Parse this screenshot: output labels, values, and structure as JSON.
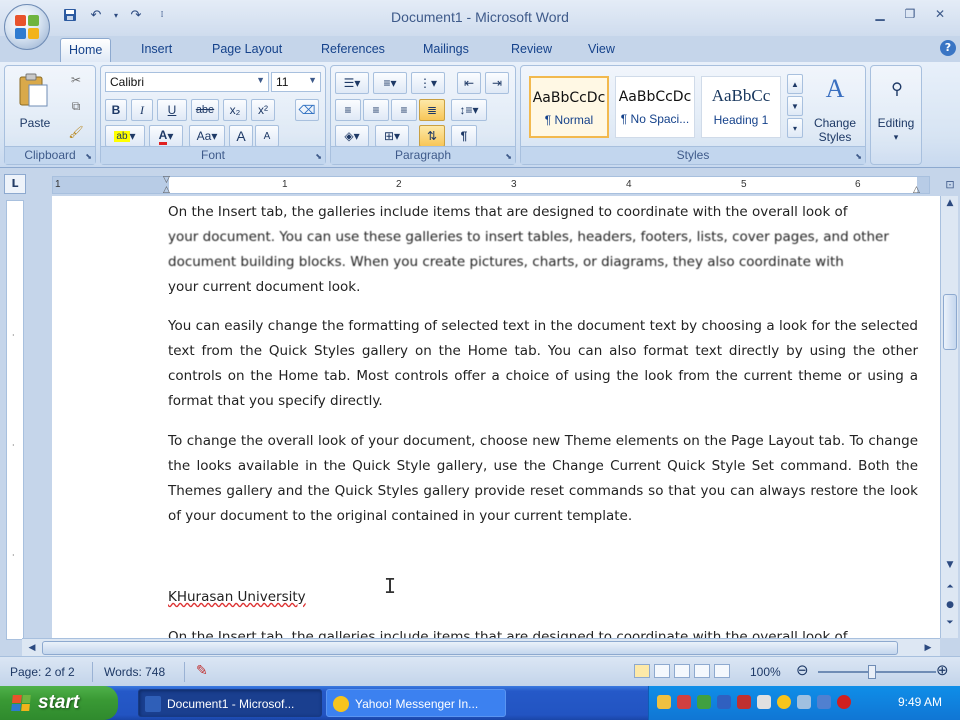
{
  "window": {
    "title": "Document1 - Microsoft Word"
  },
  "tabs": [
    "Home",
    "Insert",
    "Page Layout",
    "References",
    "Mailings",
    "Review",
    "View"
  ],
  "ribbon": {
    "clipboard": {
      "label": "Clipboard",
      "paste": "Paste"
    },
    "font": {
      "label": "Font",
      "font_name": "Calibri",
      "font_size": "11",
      "bold": "B",
      "italic": "I",
      "underline": "U",
      "strike": "abe",
      "subscript": "x₂",
      "superscript": "x²",
      "case": "Aa",
      "grow": "A",
      "shrink": "A"
    },
    "paragraph": {
      "label": "Paragraph"
    },
    "styles": {
      "label": "Styles",
      "items": [
        {
          "sample": "AaBbCcDc",
          "name": "¶ Normal"
        },
        {
          "sample": "AaBbCcDc",
          "name": "¶ No Spaci..."
        },
        {
          "sample": "AaBbCc",
          "name": "Heading 1"
        }
      ],
      "change_styles": "Change Styles"
    },
    "editing": {
      "label": "Editing"
    }
  },
  "ruler": {
    "numbers": [
      "1",
      "1",
      "2",
      "3",
      "4",
      "5",
      "6"
    ]
  },
  "document": {
    "para1_lines": [
      "On the Insert tab, the galleries include items that are designed to coordinate with the overall look of",
      "your document. You can use these galleries to insert tables, headers, footers, lists, cover pages, and other",
      "document building blocks. When you create pictures, charts, or diagrams, they also coordinate with",
      "your current document look."
    ],
    "para2": "You can easily change the formatting of selected text in the document text by choosing a look for the selected text from the Quick Styles gallery on the Home tab. You can also format text directly by using the other controls on the Home tab. Most controls offer a choice of using the look from the current theme or using a format that you specify directly.",
    "para3": "To change the overall look of your document, choose new Theme elements on the Page Layout tab. To change the looks available in the Quick Style gallery, use the Change Current Quick Style Set command. Both the Themes gallery and the Quick Styles gallery provide reset commands so that you can always restore the look of your document to the original contained in your current template.",
    "heading": "KHurasan University",
    "para4": "On the Insert tab, the galleries include items that are designed to coordinate with the overall look of"
  },
  "statusbar": {
    "page": "Page: 2 of 2",
    "words": "Words: 748",
    "zoom": "100%"
  },
  "taskbar": {
    "start": "start",
    "tasks": [
      "Document1 - Microsof...",
      "Yahoo! Messenger In..."
    ],
    "clock": "9:49 AM"
  },
  "colors": {
    "ribbon_bg": "#d7e4f3",
    "taskbar_blue": "#2254c2",
    "start_green": "#3a9a35",
    "tray_blue": "#0f8ee8"
  }
}
